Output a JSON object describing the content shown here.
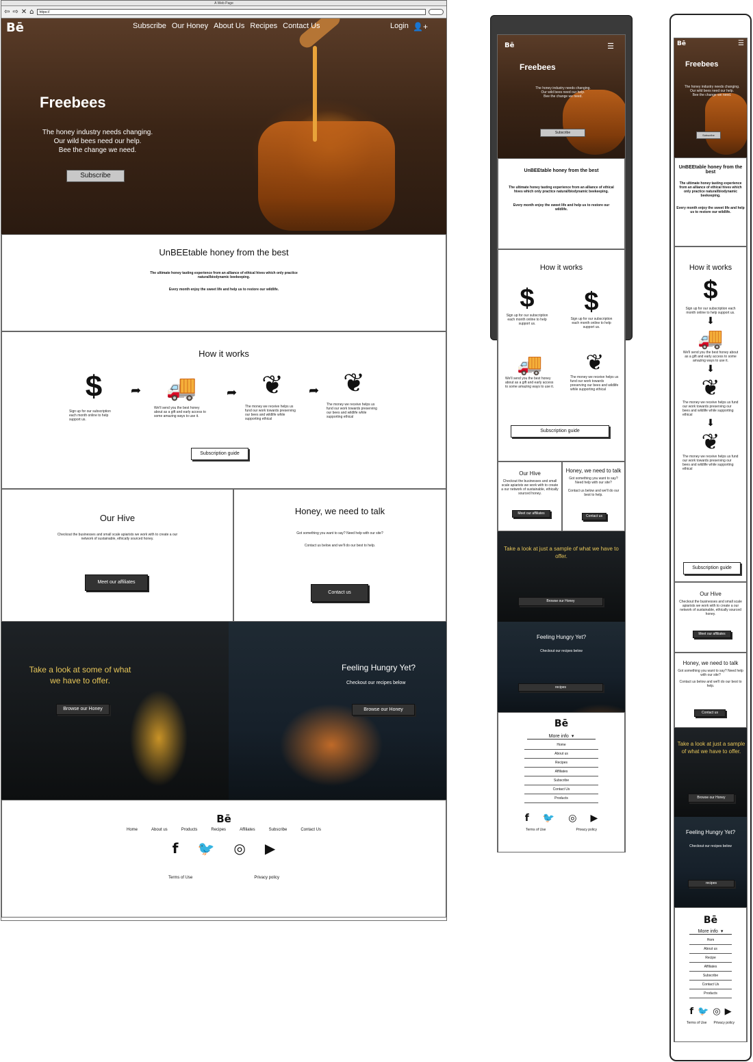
{
  "browser": {
    "title": "A Web Page",
    "url": "https://"
  },
  "brand": "Bē",
  "nav": {
    "subscribe": "Subscribe",
    "honey": "Our Honey",
    "about": "About Us",
    "recipes": "Recipes",
    "contact": "Contact Us",
    "login": "Login"
  },
  "hero": {
    "title": "Freebees",
    "line1": "The honey industry needs changing.",
    "line2": "Our wild bees need our help.",
    "line3": "Bee the change we need.",
    "button": "Subscribe"
  },
  "intro": {
    "heading": "UnBEEtable honey from the best",
    "p1": "The ultimate honey tasting experience from an alliance of ethical hives which only practice natural/biodynamic beekeeping.",
    "p2": "Every month enjoy the sweet life and help us to restore our wildlife."
  },
  "how": {
    "heading": "How it works",
    "steps": [
      {
        "icon": "dollar-icon",
        "text": "Sign up for our subscription each month online to help support us."
      },
      {
        "icon": "truck-icon",
        "text": "We'll send you the best honey about as a gift and early access to some amazing ways to use it."
      },
      {
        "icon": "leaf-icon",
        "text": "The money we receive helps us fund our work towards preserving our bees and wildlife while supporting ethical"
      },
      {
        "icon": "leaf-icon",
        "text": "The money we receive helps us fund our work towards preserving our bees and wildlife while supporting ethical"
      }
    ],
    "button": "Subscription guide"
  },
  "hive": {
    "heading": "Our Hive",
    "text": "Checkout the businesses and small scale apiarists we work with to create a our network of sustainable, ethically sourced honey.",
    "button": "Meet our affiliates"
  },
  "talk": {
    "heading": "Honey, we need to talk",
    "p1": "Got something you want to say? Need help with our site?",
    "p2": "Contact us below and we'll do our best to help.",
    "button": "Contact us"
  },
  "panels": {
    "honey_title": "Take a look at some of what we have to offer.",
    "honey_button": "Browse our Honey",
    "pancake_title": "Feeling Hungry Yet?",
    "pancake_sub": "Checkout our recipes below",
    "pancake_button": "Browse our Honey"
  },
  "footer": {
    "links": [
      "Home",
      "About us",
      "Products",
      "Recipes",
      "Affiliates",
      "Subscribe",
      "Contact Us"
    ],
    "terms": "Terms of Use",
    "privacy": "Privacy policy"
  },
  "tablet": {
    "hero_line1": "The honey industry needs changing.",
    "hero_line2": "Our wild bees need our help.",
    "hero_line3": "Bee the change we need.",
    "hive_text": "Checkout the businesses and small scale apiarists we work with to create a our network of sustainable, ethically sourced honey.",
    "talk_p1": "Got something you want to say? Need help with our site?",
    "talk_p2": "Contact us below and we'll do our best to help.",
    "panel1": "Take a look at just a sample of what we have to offer.",
    "panel2_sub": "Checkout our recipes below",
    "panel2_button": "recipes",
    "more": "More info",
    "menu": [
      "Home",
      "About us",
      "Recipes",
      "Affiliates",
      "Subscribe",
      "Contact Us",
      "Products"
    ]
  },
  "phone": {
    "menu": [
      "Hom",
      "About us",
      "Recipe",
      "Affiliates",
      "Subscribe",
      "Contact Us",
      "Products"
    ],
    "panel1": "Take a look at just a sample of what we have to offer."
  }
}
